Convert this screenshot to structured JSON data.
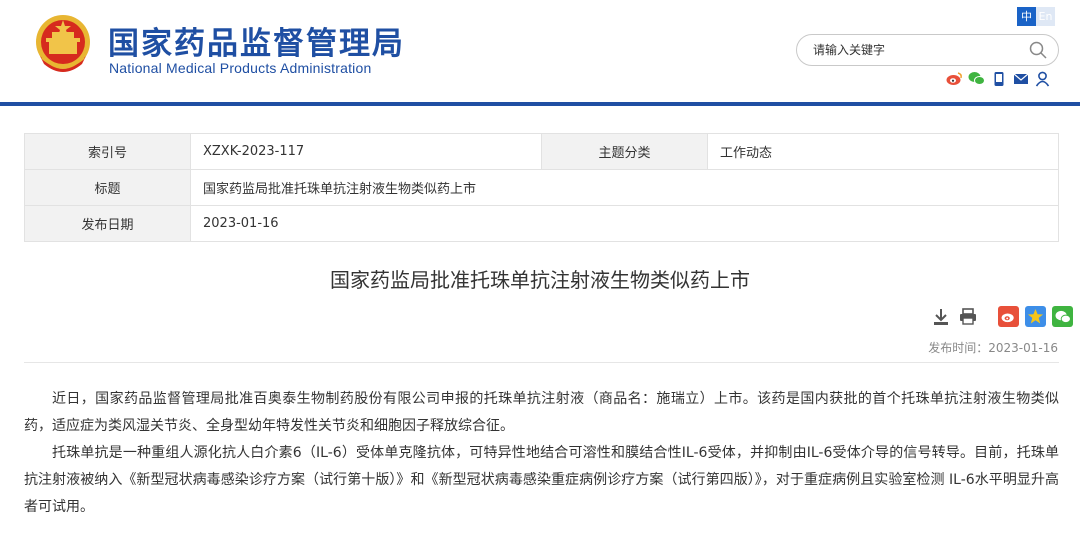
{
  "header": {
    "title_cn": "国家药品监督管理局",
    "title_en": "National Medical Products Administration",
    "lang": {
      "zh": "中",
      "en": "En"
    },
    "search": {
      "placeholder": "请输入关键字"
    },
    "social_icons": [
      "weibo-icon",
      "wechat-icon",
      "mobile-icon",
      "mail-icon",
      "user-icon"
    ]
  },
  "info_table": {
    "index_label": "索引号",
    "index_value": "XZXK-2023-117",
    "topic_label": "主题分类",
    "topic_value": "工作动态",
    "title_label": "标题",
    "title_value": "国家药监局批准托珠单抗注射液生物类似药上市",
    "date_label": "发布日期",
    "date_value": "2023-01-16"
  },
  "article": {
    "title": "国家药监局批准托珠单抗注射液生物类似药上市",
    "tools": [
      "download-icon",
      "print-icon"
    ],
    "share": [
      "weibo-share-icon",
      "qzone-share-icon",
      "wechat-share-icon"
    ],
    "pub_label": "发布时间：",
    "pub_date": "2023-01-16",
    "paragraphs": [
      "近日，国家药品监督管理局批准百奥泰生物制药股份有限公司申报的托珠单抗注射液（商品名：施瑞立）上市。该药是国内获批的首个托珠单抗注射液生物类似药，适应症为类风湿关节炎、全身型幼年特发性关节炎和细胞因子释放综合征。",
      "托珠单抗是一种重组人源化抗人白介素6（IL-6）受体单克隆抗体，可特异性地结合可溶性和膜结合性IL-6受体，并抑制由IL-6受体介导的信号转导。目前，托珠单抗注射液被纳入《新型冠状病毒感染诊疗方案（试行第十版）》和《新型冠状病毒感染重症病例诊疗方案（试行第四版）》，对于重症病例且实验室检测 IL-6水平明显升高者可试用。"
    ]
  },
  "colors": {
    "brand_blue": "#1f4fa3",
    "lang_active": "#1a63c7",
    "share_weibo": "#e8503a",
    "share_qzone": "#3d8ee8",
    "share_wechat": "#3fb440"
  }
}
